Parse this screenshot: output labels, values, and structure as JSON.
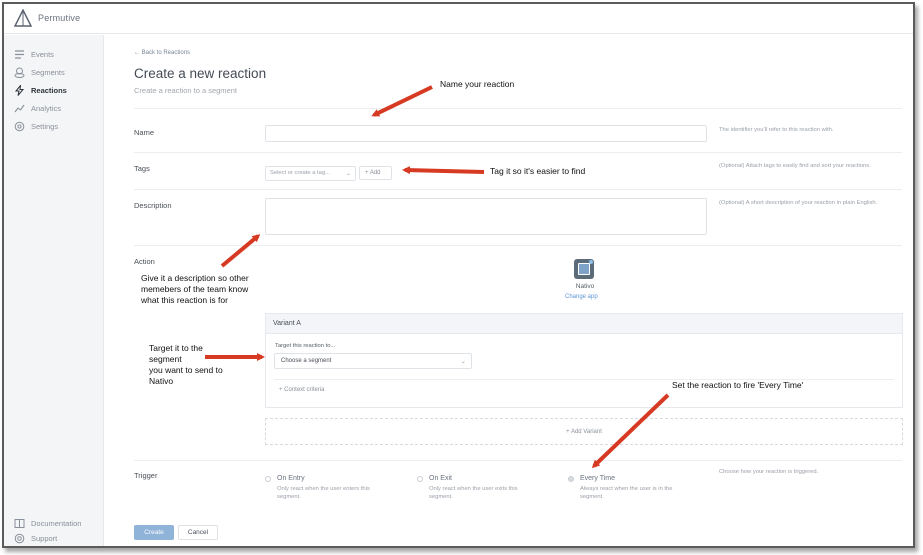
{
  "app": {
    "brand": "Permutive"
  },
  "sidebar": {
    "items": [
      {
        "label": "Events",
        "icon": "list-icon"
      },
      {
        "label": "Segments",
        "icon": "segments-icon"
      },
      {
        "label": "Reactions",
        "icon": "bolt-icon",
        "active": true
      },
      {
        "label": "Analytics",
        "icon": "analytics-icon"
      },
      {
        "label": "Settings",
        "icon": "gear-icon"
      }
    ],
    "footer": [
      {
        "label": "Documentation",
        "icon": "book-icon"
      },
      {
        "label": "Support",
        "icon": "help-icon"
      }
    ]
  },
  "page": {
    "back_label": "← Back to Reactions",
    "title": "Create a new reaction",
    "subtitle": "Create a reaction to a segment"
  },
  "form": {
    "name": {
      "label": "Name",
      "value": "",
      "hint": "The identifier you'll refer to this reaction with."
    },
    "tags": {
      "label": "Tags",
      "placeholder": "Select or create a tag...",
      "add_label": "+ Add",
      "hint": "(Optional) Attach tags to easily find and sort your reactions."
    },
    "description": {
      "label": "Description",
      "value": "",
      "hint": "(Optional) A short description of your reaction in plain English."
    },
    "action": {
      "label": "Action",
      "app_name": "Nativo",
      "change_app": "Change app",
      "variant_title": "Variant A",
      "target_label": "Target this reaction to...",
      "segment_placeholder": "Choose a segment",
      "context_criteria": "+ Context criteria",
      "add_variant": "+ Add Variant"
    },
    "trigger": {
      "label": "Trigger",
      "hint": "Choose how your reaction is triggered.",
      "options": [
        {
          "title": "On Entry",
          "desc": "Only react when the user enters this segment."
        },
        {
          "title": "On Exit",
          "desc": "Only react when the user exits this segment."
        },
        {
          "title": "Every Time",
          "desc": "Always react when the user is in the segment.",
          "selected": true
        }
      ]
    },
    "buttons": {
      "create": "Create",
      "cancel": "Cancel"
    }
  },
  "annotations": {
    "name": "Name your reaction",
    "tags": "Tag it so it's easier to find",
    "desc_line1": "Give it a description so other",
    "desc_line2": "memebers of the team know",
    "desc_line3": "what this reaction is for",
    "target_line1": "Target it to the",
    "target_line2": "segment",
    "target_line3": "you want to send to",
    "target_line4": "Nativo",
    "trigger": "Set the reaction to fire 'Every Time'"
  },
  "colors": {
    "accent": "#5b97d6",
    "arrow": "#d63a22",
    "create_button": "#8fb3d9"
  }
}
